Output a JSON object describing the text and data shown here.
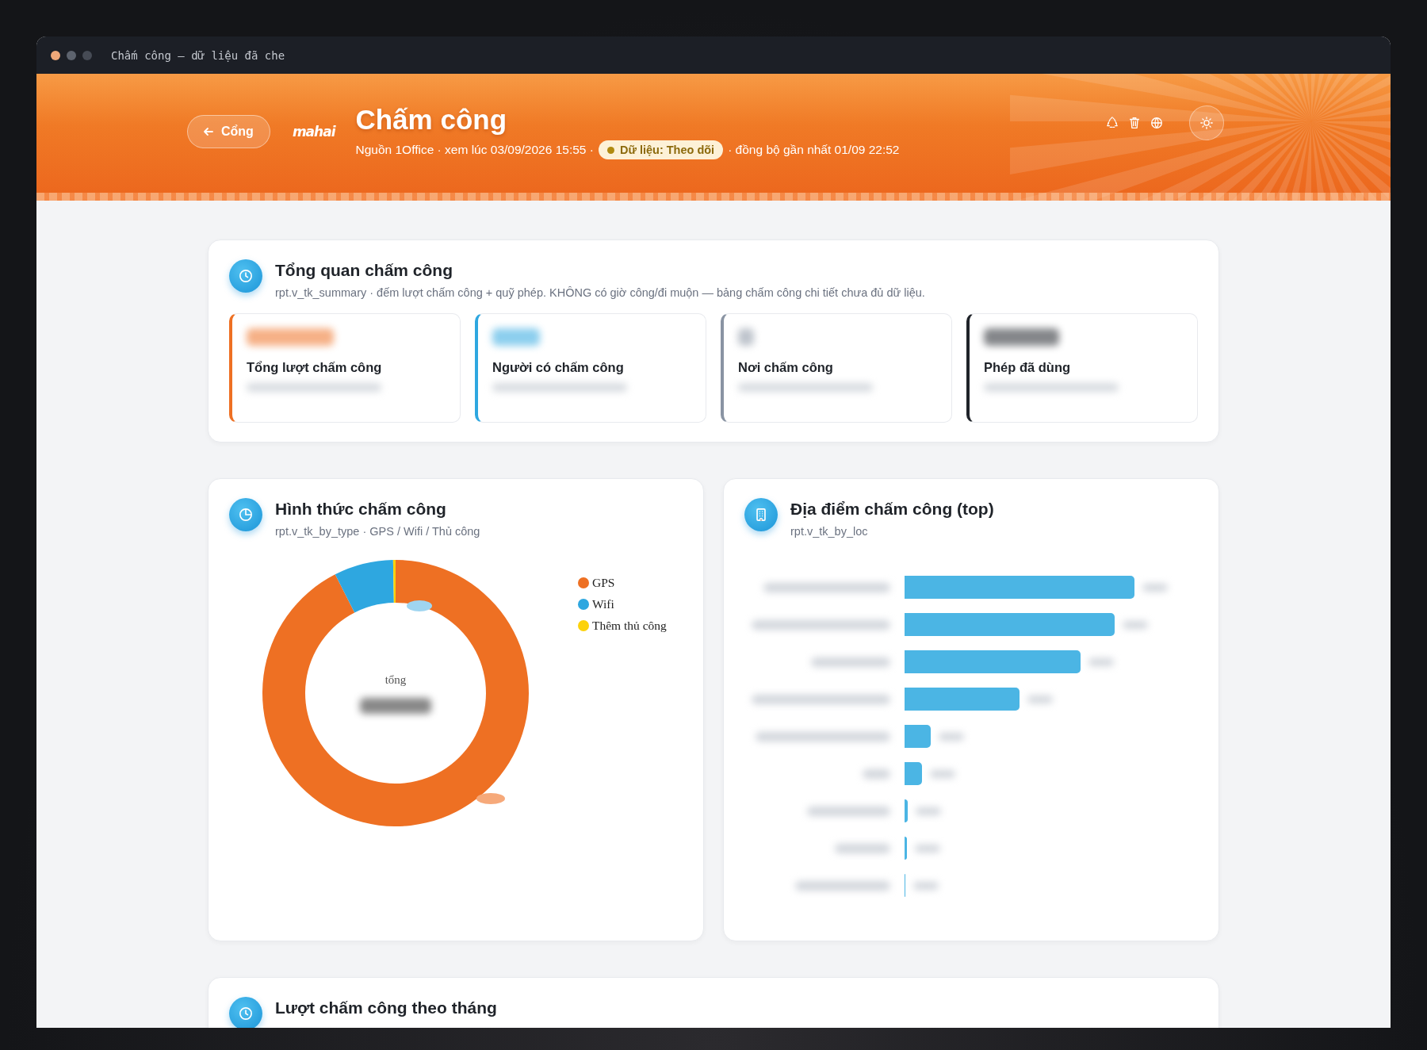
{
  "window": {
    "title": "Chấm công — dữ liệu đã che"
  },
  "header": {
    "back_button": "Cổng",
    "logo": "mahai",
    "title": "Chấm công",
    "meta_before": "Nguồn 1Office · xem lúc 03/09/2026 15:55 ·",
    "badge": "Dữ liệu: Theo dõi",
    "meta_after": "· đồng bộ gần nhất 01/09 22:52"
  },
  "summary": {
    "title": "Tổng quan chấm công",
    "subtitle": "rpt.v_tk_summary · đếm lượt chấm công + quỹ phép. KHÔNG có giờ công/đi muộn — bảng chấm công chi tiết chưa đủ dữ liệu.",
    "stats": [
      {
        "label": "Tổng lượt chấm công",
        "color": "#ee7023"
      },
      {
        "label": "Người có chấm công",
        "color": "#2ea7e0"
      },
      {
        "label": "Nơi chấm công",
        "color": "#8a94a3"
      },
      {
        "label": "Phép đã dùng",
        "color": "#1f2329"
      }
    ]
  },
  "by_type": {
    "title": "Hình thức chấm công",
    "subtitle": "rpt.v_tk_by_type · GPS / Wifi / Thủ công",
    "center_label": "tổng",
    "legend": [
      {
        "label": "GPS",
        "color": "#ee7023"
      },
      {
        "label": "Wifi",
        "color": "#2ea7e0"
      },
      {
        "label": "Thêm thủ công",
        "color": "#fcd20a"
      }
    ]
  },
  "by_location": {
    "title": "Địa điểm chấm công (top)",
    "subtitle": "rpt.v_tk_by_loc"
  },
  "by_month": {
    "title": "Lượt chấm công theo tháng"
  }
}
